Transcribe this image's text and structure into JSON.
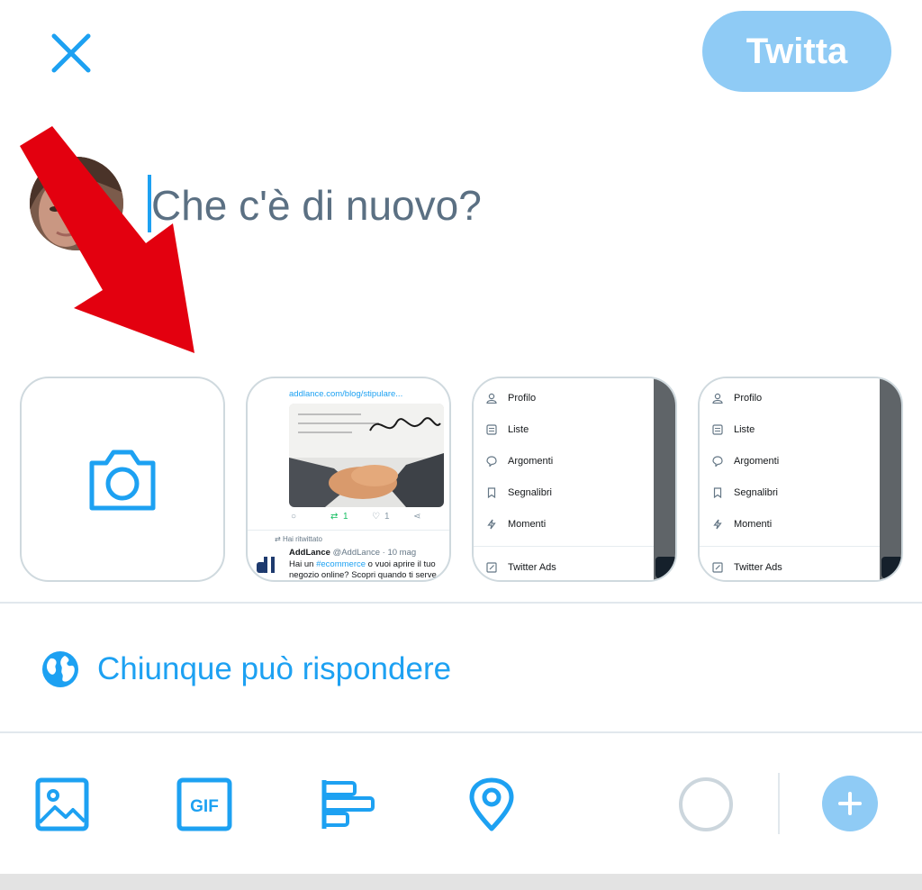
{
  "header": {
    "close_icon": "close-icon",
    "tweet_button": "Twitta"
  },
  "composer": {
    "placeholder": "Che c'è di nuovo?"
  },
  "media_preview": {
    "tweet_card": {
      "link": "addlance.com/blog/stipulare...",
      "retweets": "1",
      "likes": "1",
      "retweet_note": "Hai ritwittato",
      "author_name": "AddLance",
      "author_handle": "@AddLance · 10 mag",
      "text_before": "Hai un ",
      "hashtag": "#ecommerce",
      "text_after": " o vuoi aprire il tuo negozio online? Scopri quando ti serve"
    },
    "menu_cards": [
      {
        "items": [
          "Profilo",
          "Liste",
          "Argomenti",
          "Segnalibri",
          "Momenti"
        ],
        "footer": "Twitter Ads"
      },
      {
        "items": [
          "Profilo",
          "Liste",
          "Argomenti",
          "Segnalibri",
          "Momenti"
        ],
        "footer": "Twitter Ads"
      }
    ]
  },
  "reply_settings": {
    "label": "Chiunque può rispondere",
    "icon": "globe-icon"
  },
  "toolbar": {
    "icons": [
      "image-icon",
      "gif-icon",
      "poll-icon",
      "location-icon",
      "character-counter",
      "add-thread-icon"
    ],
    "gif_label": "GIF"
  },
  "colors": {
    "accent": "#1da1f2",
    "button_disabled": "#8fcbf5",
    "arrow": "#e3000f",
    "divider": "#e1e8ed"
  }
}
